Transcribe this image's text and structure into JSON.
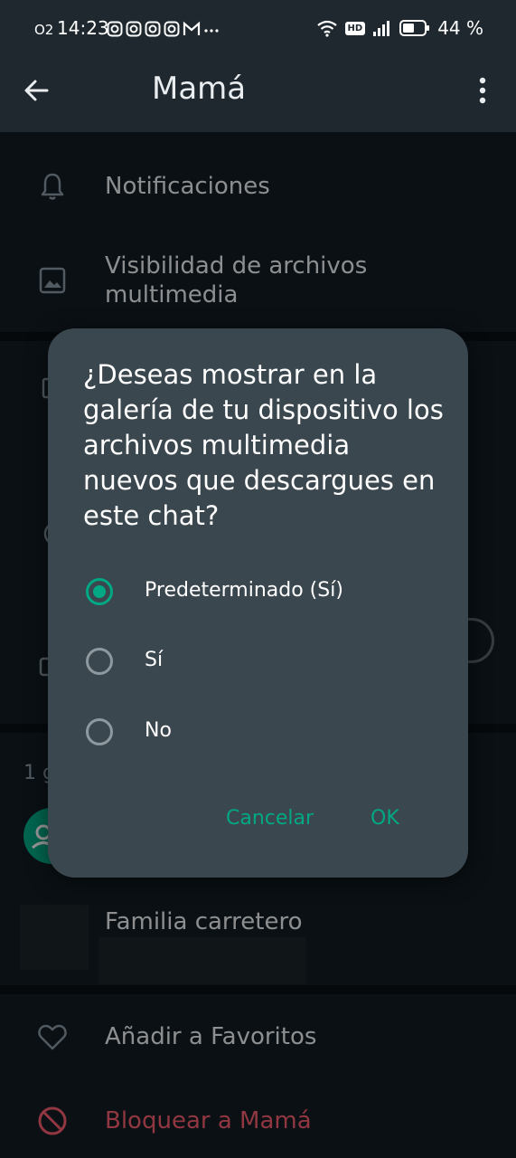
{
  "status_bar": {
    "small_label": "O2",
    "time": "14:23",
    "network_badge": "HD",
    "battery_percent": "44 %",
    "notification_icons": [
      "instagram-icon",
      "instagram-icon",
      "instagram-icon",
      "instagram-icon",
      "gmail-icon",
      "more-icon"
    ]
  },
  "app_bar": {
    "title": "Mamá"
  },
  "settings": {
    "notifications_label": "Notificaciones",
    "media_visibility_label": "Visibilidad de archivos multimedia",
    "groups_count_partial": "1 g",
    "group_name": "Familia carretero",
    "favorites_label": "Añadir a Favoritos",
    "block_label": "Bloquear a Mamá"
  },
  "dialog": {
    "question": "¿Deseas mostrar en la galería de tu dispositivo los archivos multimedia nuevos que descargues en este chat?",
    "options": [
      {
        "label": "Predeterminado (Sí)",
        "selected": true
      },
      {
        "label": "Sí",
        "selected": false
      },
      {
        "label": "No",
        "selected": false
      }
    ],
    "cancel_label": "Cancelar",
    "ok_label": "OK"
  },
  "colors": {
    "accent": "#00a884",
    "danger": "#f15c6d",
    "dialog_bg": "#3b474e",
    "background": "#121b22"
  }
}
